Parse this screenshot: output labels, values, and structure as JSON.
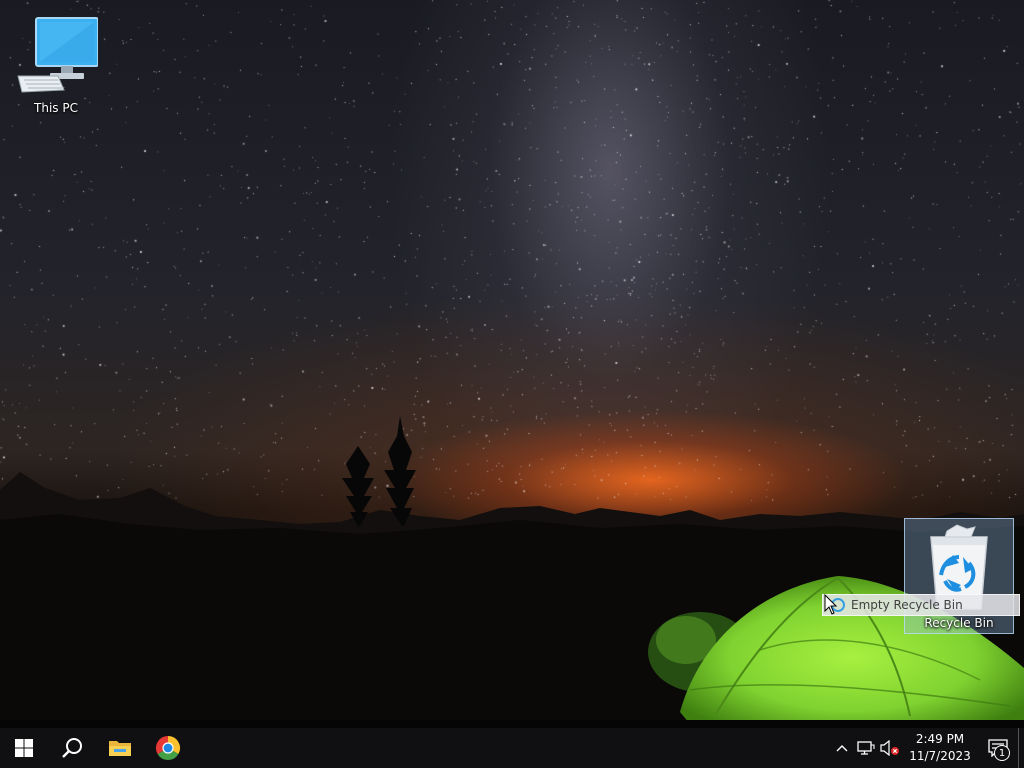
{
  "desktop": {
    "wallpaper": "night-sky-milky-way-camping-tent",
    "icons": [
      {
        "label": "This PC",
        "icon": "this-pc-icon"
      },
      {
        "label": "Recycle Bin",
        "icon": "recycle-bin-icon"
      }
    ]
  },
  "drag_tooltip": {
    "text": "Empty Recycle Bin"
  },
  "taskbar": {
    "buttons": [
      {
        "name": "start",
        "icon": "windows-logo-icon"
      },
      {
        "name": "search",
        "icon": "search-icon"
      },
      {
        "name": "file-explorer",
        "icon": "folder-icon"
      },
      {
        "name": "chrome",
        "icon": "chrome-icon"
      }
    ],
    "tray": {
      "icons": [
        "chevron-up-icon",
        "network-icon",
        "volume-muted-icon"
      ],
      "time": "2:49 PM",
      "date": "11/7/2023",
      "notification_count": "1"
    }
  },
  "colors": {
    "taskbar": "#101012",
    "accent": "#37a0e0",
    "tent": "#7fd230"
  }
}
